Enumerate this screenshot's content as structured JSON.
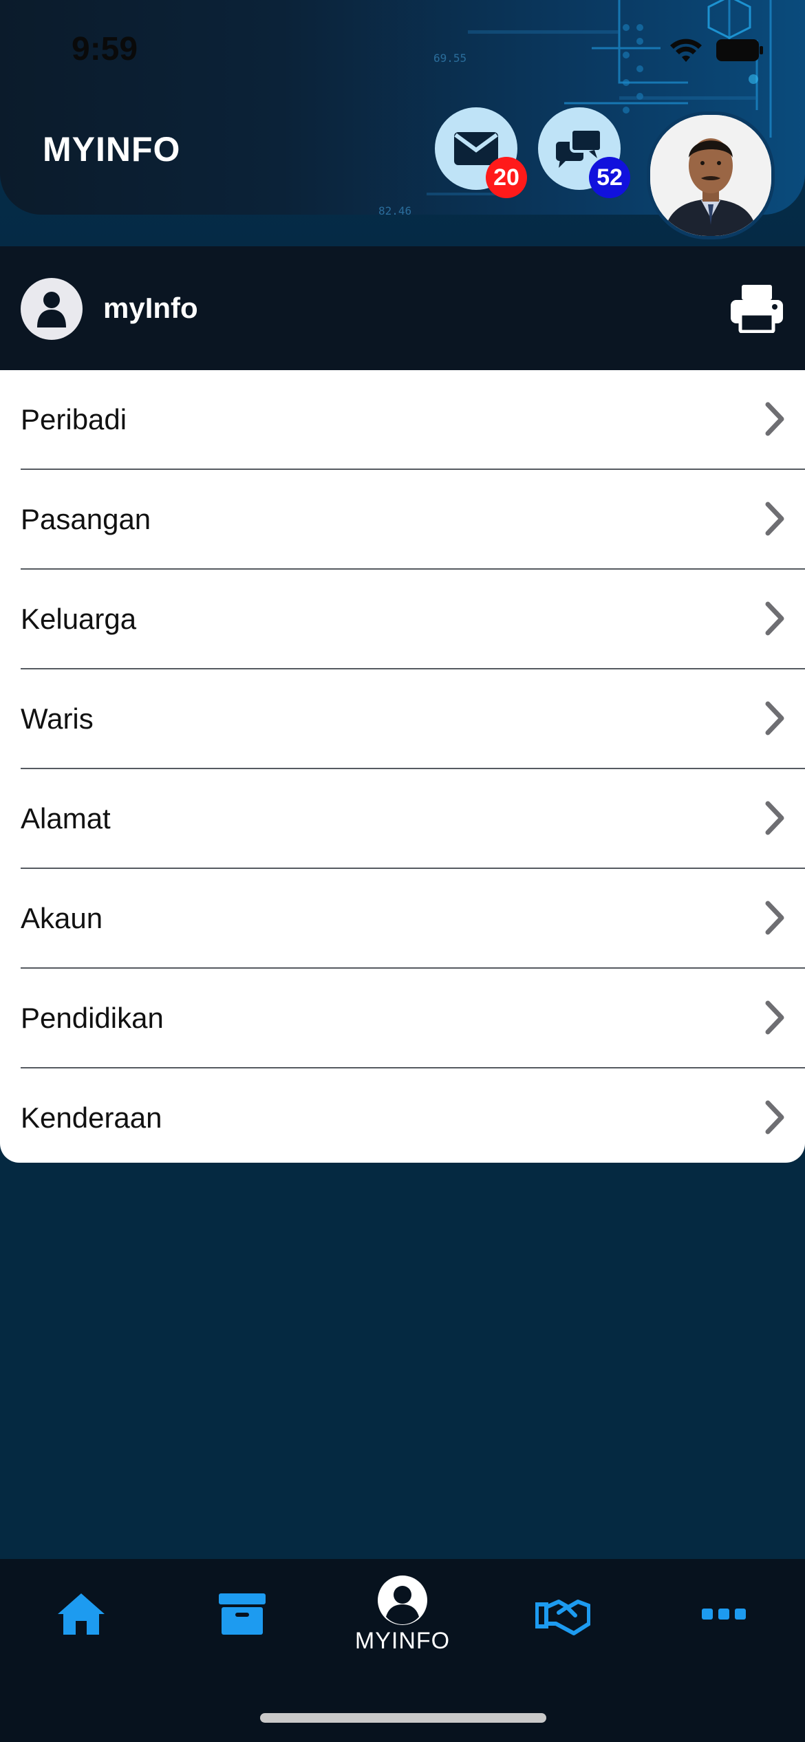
{
  "status_bar": {
    "time": "9:59"
  },
  "header": {
    "title": "MYINFO",
    "mail_count": "20",
    "chat_count": "52",
    "circuit_text_1": "69.55",
    "circuit_text_2": "82.46"
  },
  "section": {
    "title": "myInfo"
  },
  "menu": [
    {
      "label": "Peribadi"
    },
    {
      "label": "Pasangan"
    },
    {
      "label": "Keluarga"
    },
    {
      "label": "Waris"
    },
    {
      "label": "Alamat"
    },
    {
      "label": "Akaun"
    },
    {
      "label": "Pendidikan"
    },
    {
      "label": "Kenderaan"
    }
  ],
  "tabbar": {
    "items": [
      {
        "icon": "home-icon"
      },
      {
        "icon": "archive-icon"
      },
      {
        "icon": "user-circle-icon",
        "label": "MYINFO"
      },
      {
        "icon": "handshake-icon"
      },
      {
        "icon": "more-icon"
      }
    ]
  },
  "colors": {
    "accent_blue": "#1d9bf0",
    "mail_badge": "#ff1a1a",
    "chat_badge": "#1111dd",
    "background": "#052941"
  }
}
